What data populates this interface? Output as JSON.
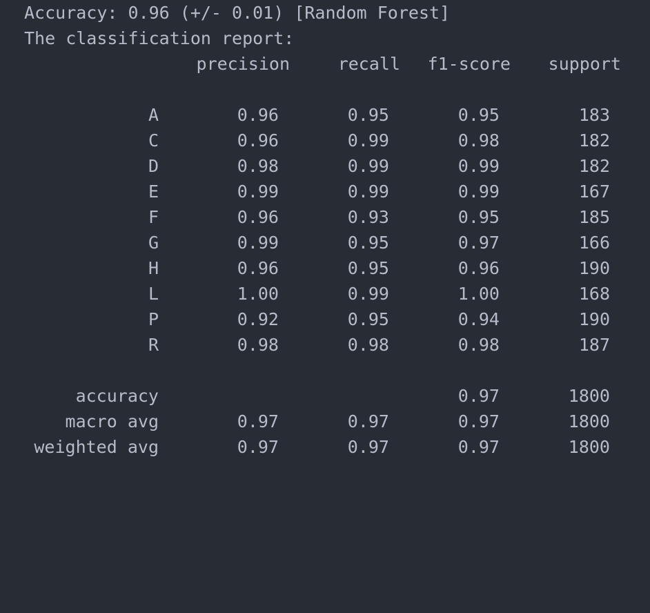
{
  "accuracy_line": "Accuracy: 0.96 (+/- 0.01) [Random Forest]",
  "report_title": "The classification report:",
  "headers": {
    "precision": "precision",
    "recall": "recall",
    "f1": "f1-score",
    "support": "support"
  },
  "rows": [
    {
      "label": "A",
      "precision": "0.96",
      "recall": "0.95",
      "f1": "0.95",
      "support": "183"
    },
    {
      "label": "C",
      "precision": "0.96",
      "recall": "0.99",
      "f1": "0.98",
      "support": "182"
    },
    {
      "label": "D",
      "precision": "0.98",
      "recall": "0.99",
      "f1": "0.99",
      "support": "182"
    },
    {
      "label": "E",
      "precision": "0.99",
      "recall": "0.99",
      "f1": "0.99",
      "support": "167"
    },
    {
      "label": "F",
      "precision": "0.96",
      "recall": "0.93",
      "f1": "0.95",
      "support": "185"
    },
    {
      "label": "G",
      "precision": "0.99",
      "recall": "0.95",
      "f1": "0.97",
      "support": "166"
    },
    {
      "label": "H",
      "precision": "0.96",
      "recall": "0.95",
      "f1": "0.96",
      "support": "190"
    },
    {
      "label": "L",
      "precision": "1.00",
      "recall": "0.99",
      "f1": "1.00",
      "support": "168"
    },
    {
      "label": "P",
      "precision": "0.92",
      "recall": "0.95",
      "f1": "0.94",
      "support": "190"
    },
    {
      "label": "R",
      "precision": "0.98",
      "recall": "0.98",
      "f1": "0.98",
      "support": "187"
    }
  ],
  "summary": {
    "accuracy": {
      "label": "accuracy",
      "f1": "0.97",
      "support": "1800"
    },
    "macro_avg": {
      "label": "macro avg",
      "precision": "0.97",
      "recall": "0.97",
      "f1": "0.97",
      "support": "1800"
    },
    "weighted_avg": {
      "label": "weighted avg",
      "precision": "0.97",
      "recall": "0.97",
      "f1": "0.97",
      "support": "1800"
    }
  }
}
